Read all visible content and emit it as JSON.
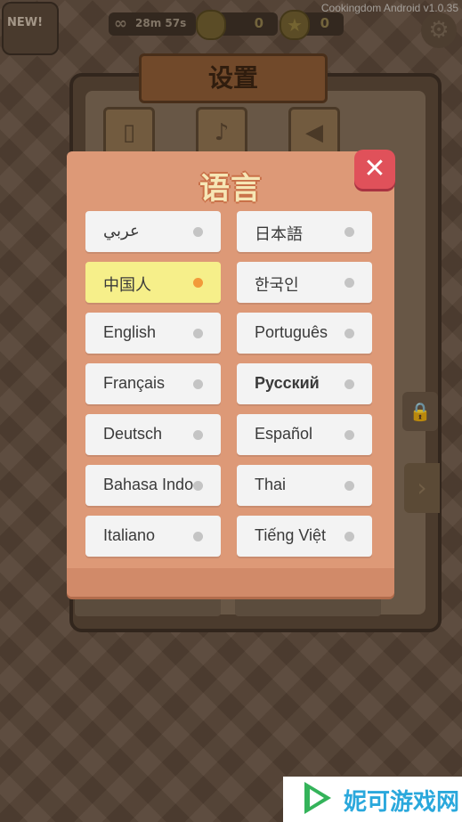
{
  "version": "Cookingdom Android v1.0.35",
  "topbar": {
    "avatar_label": "NEW!",
    "timer": "28m 57s",
    "coins": "0",
    "stars": "0"
  },
  "settings": {
    "title": "设置"
  },
  "dialog": {
    "title": "语言",
    "close_symbol": "✕",
    "languages": [
      {
        "label": "عربي",
        "selected": false
      },
      {
        "label": "日本語",
        "selected": false
      },
      {
        "label": "中国人",
        "selected": true
      },
      {
        "label": "한국인",
        "selected": false
      },
      {
        "label": "English",
        "selected": false
      },
      {
        "label": "Português",
        "selected": false
      },
      {
        "label": "Français",
        "selected": false
      },
      {
        "label": "Русский",
        "selected": false
      },
      {
        "label": "Deutsch",
        "selected": false
      },
      {
        "label": "Español",
        "selected": false
      },
      {
        "label": "Bahasa Indo",
        "selected": false
      },
      {
        "label": "Thai",
        "selected": false
      },
      {
        "label": "Italiano",
        "selected": false
      },
      {
        "label": "Tiếng Việt",
        "selected": false
      }
    ]
  },
  "colors": {
    "dialog_bg": "#dd9977",
    "selected_bg": "#f6ef8a",
    "selected_dot": "#f29a3a",
    "close_btn": "#e0515a"
  },
  "watermark": {
    "text": "妮可游戏网"
  }
}
